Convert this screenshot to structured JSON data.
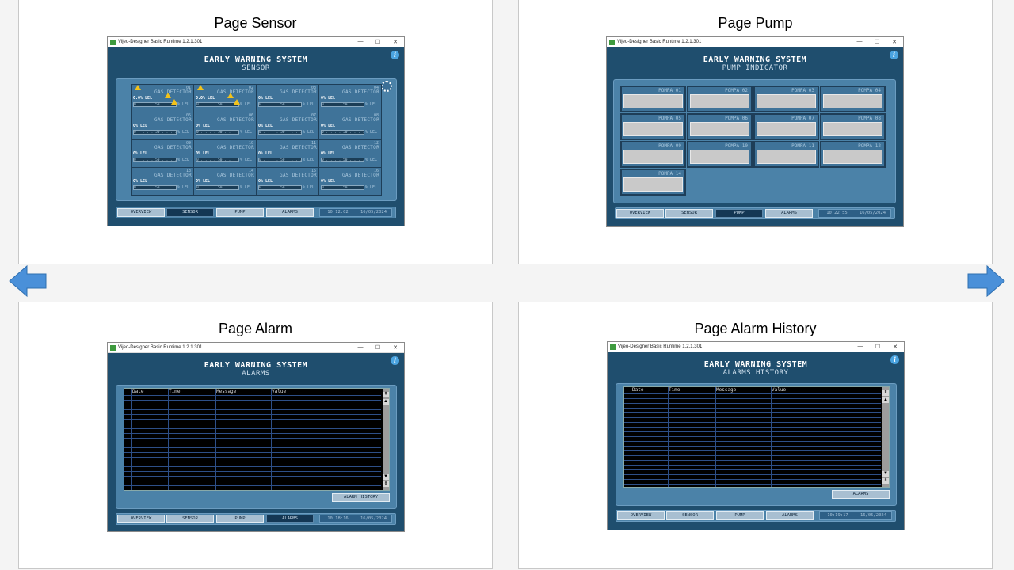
{
  "cards": {
    "sensor": {
      "title": "Page Sensor"
    },
    "pump": {
      "title": "Page Pump"
    },
    "alarm": {
      "title": "Page Alarm"
    },
    "history": {
      "title": "Page Alarm History"
    }
  },
  "window": {
    "app_title": "Vijeo-Designer Basic Runtime 1.2.1.301",
    "minimize": "—",
    "maximize": "☐",
    "close": "✕",
    "info": "i"
  },
  "header_title": "EARLY WARNING SYSTEM",
  "sensor_page": {
    "subtitle": "SENSOR",
    "time": "10:12:02",
    "date": "16/05/2024",
    "cells": [
      {
        "num": "01",
        "name": "GAS DETECTOR",
        "lel": "0.0% LEL",
        "bar": "0 . . . . 50 . . . . 100%",
        "unit": "% LEL"
      },
      {
        "num": "02",
        "name": "GAS DETECTOR",
        "lel": "0.0% LEL",
        "bar": "0 . . . . 50 . . . . 100%",
        "unit": "% LEL"
      },
      {
        "num": "03",
        "name": "GAS DETECTOR",
        "lel": "0% LEL",
        "bar": "0 . . . . 50 . . . . 100%",
        "unit": "% LEL"
      },
      {
        "num": "04",
        "name": "GAS DETECTOR",
        "lel": "0% LEL",
        "bar": "0 . . . . 50 . . . . 100%",
        "unit": "% LEL"
      },
      {
        "num": "05",
        "name": "GAS DETECTOR",
        "lel": "0% LEL",
        "bar": "0 . . . . 50 . . . . 100%",
        "unit": "% LEL"
      },
      {
        "num": "06",
        "name": "GAS DETECTOR",
        "lel": "0% LEL",
        "bar": "0 . . . . 50 . . . . 100%",
        "unit": "% LEL"
      },
      {
        "num": "07",
        "name": "GAS DETECTOR",
        "lel": "0% LEL",
        "bar": "0 . . . . 50 . . . . 100%",
        "unit": "% LEL"
      },
      {
        "num": "08",
        "name": "GAS DETECTOR",
        "lel": "0% LEL",
        "bar": "0 . . . . 50 . . . . 100%",
        "unit": "% LEL"
      },
      {
        "num": "09",
        "name": "GAS DETECTOR",
        "lel": "0% LEL",
        "bar": "0 . . . . 50 . . . . 100%",
        "unit": "% LEL"
      },
      {
        "num": "10",
        "name": "GAS DETECTOR",
        "lel": "0% LEL",
        "bar": "0 . . . . 50 . . . . 100%",
        "unit": "% LEL"
      },
      {
        "num": "11",
        "name": "GAS DETECTOR",
        "lel": "0% LEL",
        "bar": "0 . . . . 50 . . . . 100%",
        "unit": "% LEL"
      },
      {
        "num": "12",
        "name": "GAS DETECTOR",
        "lel": "0% LEL",
        "bar": "0 . . . . 50 . . . . 100%",
        "unit": "% LEL"
      },
      {
        "num": "13",
        "name": "GAS DETECTOR",
        "lel": "0% LEL",
        "bar": "0 . . . . 50 . . . . 100%",
        "unit": "% LEL"
      },
      {
        "num": "14",
        "name": "GAS DETECTOR",
        "lel": "0% LEL",
        "bar": "0 . . . . 50 . . . . 100%",
        "unit": "% LEL"
      },
      {
        "num": "15",
        "name": "GAS DETECTOR",
        "lel": "0% LEL",
        "bar": "0 . . . . 50 . . . . 100%",
        "unit": "% LEL"
      },
      {
        "num": "16",
        "name": "GAS DETECTOR",
        "lel": "0% LEL",
        "bar": "0 . . . . 50 . . . . 100%",
        "unit": "% LEL"
      }
    ]
  },
  "pump_page": {
    "subtitle": "PUMP INDICATOR",
    "time": "10:22:55",
    "date": "16/05/2024",
    "pumps": [
      "POMPA 01",
      "POMPA 02",
      "POMPA 03",
      "POMPA 04",
      "POMPA 05",
      "POMPA 06",
      "POMPA 07",
      "POMPA 08",
      "POMPA 09",
      "POMPA 10",
      "POMPA 11",
      "POMPA 12",
      "POMPA 14"
    ]
  },
  "alarm_page": {
    "subtitle": "ALARMS",
    "time": "10:18:16",
    "date": "16/05/2024",
    "action_button": "ALARM HISTORY"
  },
  "history_page": {
    "subtitle": "ALARMS HISTORY",
    "time": "10:19:17",
    "date": "16/05/2024",
    "action_button": "ALARMS"
  },
  "table_columns": [
    "Date",
    "Time",
    "Message",
    "Value"
  ],
  "scroll": {
    "top": "⇞",
    "up": "▲",
    "down": "▼",
    "bottom": "⇟"
  },
  "nav": {
    "overview": "OVERVIEW",
    "sensor": "SENSOR",
    "pump": "PUMP",
    "alarms": "ALARMS"
  },
  "colors": {
    "hmi_bg": "#1f4e6e",
    "panel": "#4b82a8",
    "warning": "#f3c21a",
    "arrow": "#4a90d9"
  }
}
